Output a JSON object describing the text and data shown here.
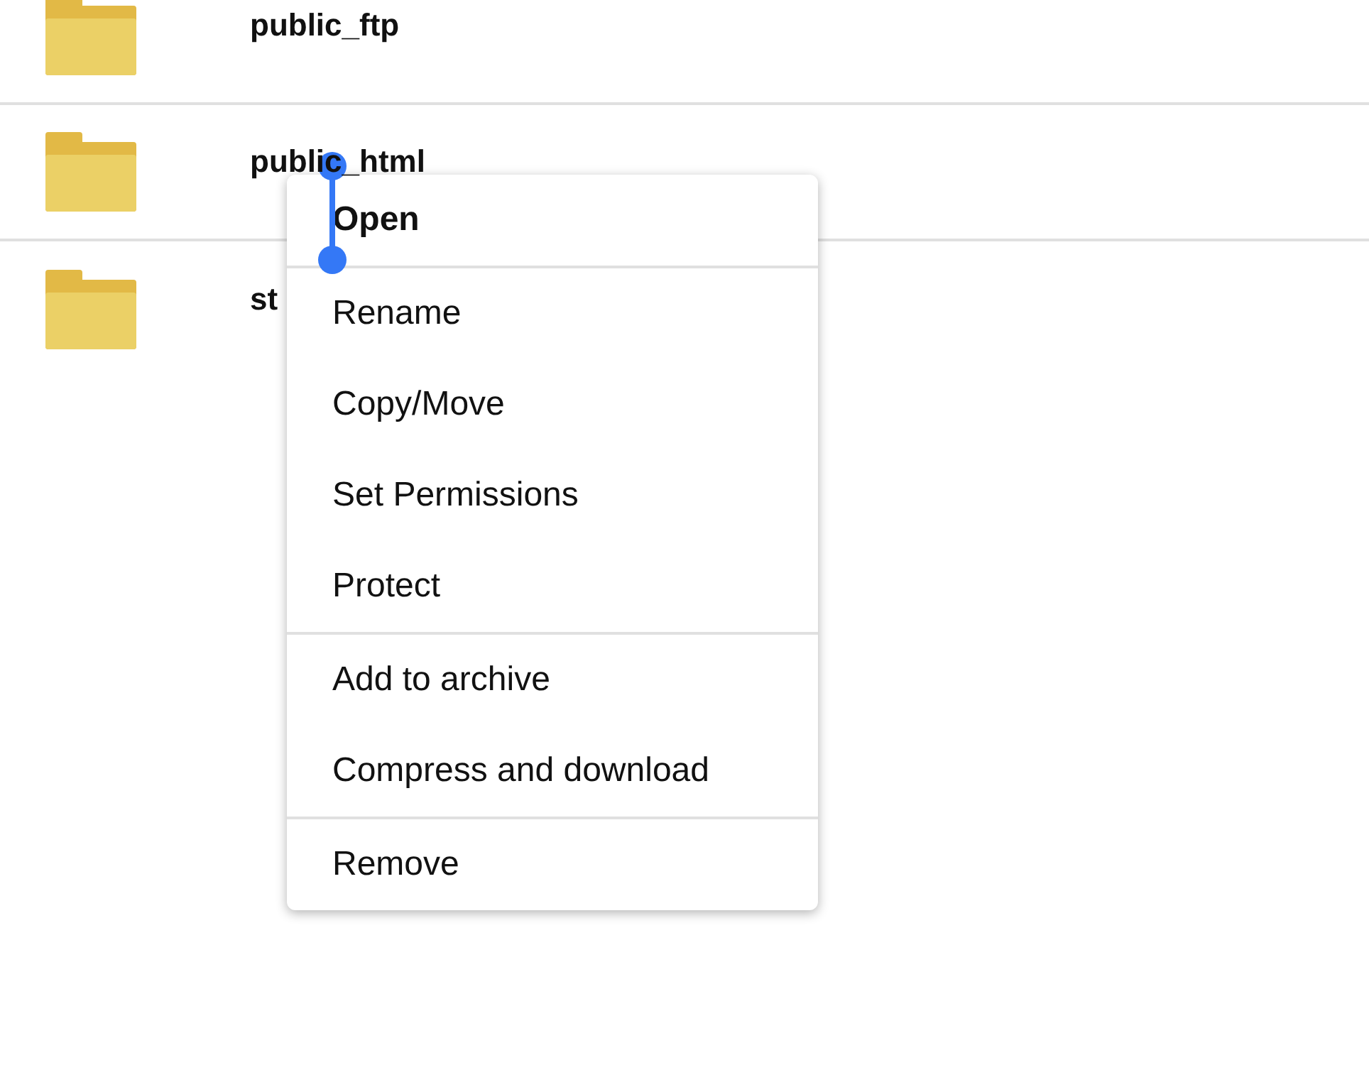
{
  "files": [
    {
      "name": "public_ftp",
      "kind": "folder"
    },
    {
      "name": "public_html",
      "kind": "folder"
    },
    {
      "name": "st",
      "kind": "folder"
    }
  ],
  "context_menu": {
    "items": [
      {
        "label": "Open",
        "default": true,
        "divider_after": true
      },
      {
        "label": "Rename",
        "default": false,
        "divider_after": false
      },
      {
        "label": "Copy/Move",
        "default": false,
        "divider_after": false
      },
      {
        "label": "Set Permissions",
        "default": false,
        "divider_after": false
      },
      {
        "label": "Protect",
        "default": false,
        "divider_after": true
      },
      {
        "label": "Add to archive",
        "default": false,
        "divider_after": false
      },
      {
        "label": "Compress and download",
        "default": false,
        "divider_after": true
      },
      {
        "label": "Remove",
        "default": false,
        "divider_after": false
      }
    ]
  }
}
